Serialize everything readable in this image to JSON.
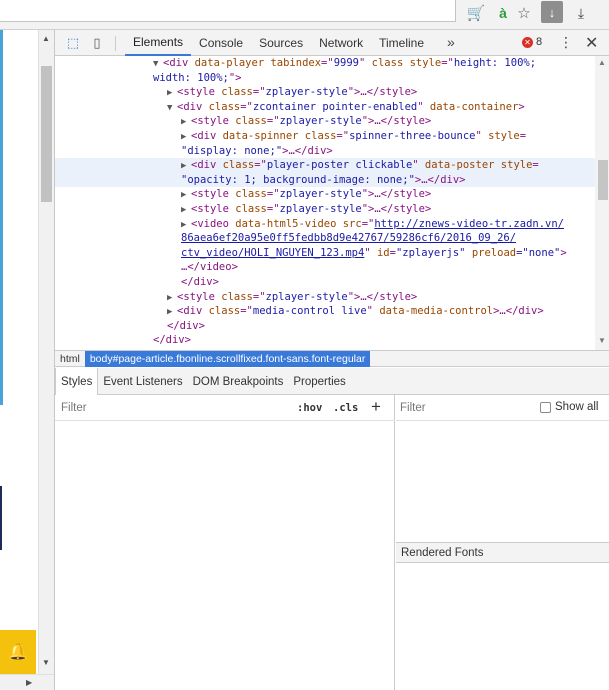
{
  "browser": {
    "icons": [
      "cart-icon",
      "aa-icon",
      "star-icon",
      "download-active-icon",
      "download-icon"
    ]
  },
  "devtools": {
    "tabs": [
      {
        "label": "Elements",
        "active": true
      },
      {
        "label": "Console"
      },
      {
        "label": "Sources"
      },
      {
        "label": "Network"
      },
      {
        "label": "Timeline"
      }
    ],
    "more_tabs": "»",
    "error_count": "8",
    "tree": {
      "line0": {
        "a": "<div ",
        "attr1": "data-player ",
        "attr2": "tabindex",
        "eq1": "=\"",
        "v1": "9999",
        "q1": "\" ",
        "attr3": "class ",
        "attr4": "style",
        "eq2": "=\"",
        "v2": "height: 100%;"
      },
      "line1": {
        "v": "width: 100%;",
        "end": "\">"
      },
      "line2": {
        "open": "<style ",
        "attr": "class",
        "val": "zplayer-style",
        "rest": "\">…</style>"
      },
      "line3": {
        "open": "<div ",
        "attr1": "class",
        "val1": "zcontainer pointer-enabled",
        "attr2": " data-container",
        "end": ">"
      },
      "line4": {
        "open": "<style ",
        "attr": "class",
        "val": "zplayer-style",
        "rest": "\">…</style>"
      },
      "line5": {
        "open": "<div ",
        "attr1": "data-spinner ",
        "attr2": "class",
        "val": "spinner-three-bounce",
        "attr3": " style",
        "end": "="
      },
      "line6": {
        "v": "\"display: none;\"",
        "rest": ">…</div>"
      },
      "line7": {
        "open": "<div ",
        "attr1": "class",
        "val": "player-poster clickable",
        "attr2": " data-poster ",
        "attr3": "style",
        "end": "="
      },
      "line8": {
        "v": "\"opacity: 1; background-image: none;\"",
        "rest": ">…</div>"
      },
      "line9": {
        "open": "<style ",
        "attr": "class",
        "val": "zplayer-style",
        "rest": "\">…</style>"
      },
      "line10": {
        "open": "<style ",
        "attr": "class",
        "val": "zplayer-style",
        "rest": "\">…</style>"
      },
      "line11": {
        "open": "<video ",
        "attr1": "data-html5-video ",
        "attr2": "src",
        "eq": "=\"",
        "link": "http://znews-video-tr.zadn.vn/"
      },
      "line12": {
        "link": "86aea6ef20a95e0ff5fedbb8d9e42767/59286cf6/2016_09_26/"
      },
      "line13": {
        "link": "ctv_video/HOLI_NGUYEN_123.mp4",
        "q": "\" ",
        "attr1": "id",
        "v1": "\"zplayerjs\"",
        "attr2": " preload",
        "v2": "=\"none\"",
        "end": ">"
      },
      "line14": {
        "text": "…</video>"
      },
      "line15": {
        "text": "</div>"
      },
      "line16": {
        "open": "<style ",
        "attr": "class",
        "val": "zplayer-style",
        "rest": "\">…</style>"
      },
      "line17": {
        "open": "<div ",
        "attr": "class",
        "val": "media-control live",
        "attr2": " data-media-control",
        "rest": ">…</div>"
      },
      "line18": {
        "text": "</div>"
      },
      "line19": {
        "text": "</div>"
      }
    },
    "breadcrumbs": [
      {
        "label": "html"
      },
      {
        "label": "body#page-article.fbonline.scrollfixed.font-sans.font-regular",
        "selected": true
      }
    ],
    "sub_tabs": [
      {
        "label": "Styles",
        "active": true
      },
      {
        "label": "Event Listeners"
      },
      {
        "label": "DOM Breakpoints"
      },
      {
        "label": "Properties"
      }
    ],
    "styles": {
      "filter_placeholder": "Filter",
      "hov": ":hov",
      "cls": ".cls",
      "plus": "+"
    },
    "computed": {
      "filter_placeholder": "Filter",
      "show_all": "Show all",
      "rendered_fonts": "Rendered Fonts"
    }
  },
  "colors": {
    "accent": "#3879d9",
    "tag": "#881280",
    "attr": "#994500",
    "value": "#1a1aa6",
    "error": "#d93025",
    "notification": "#f4c20d"
  }
}
